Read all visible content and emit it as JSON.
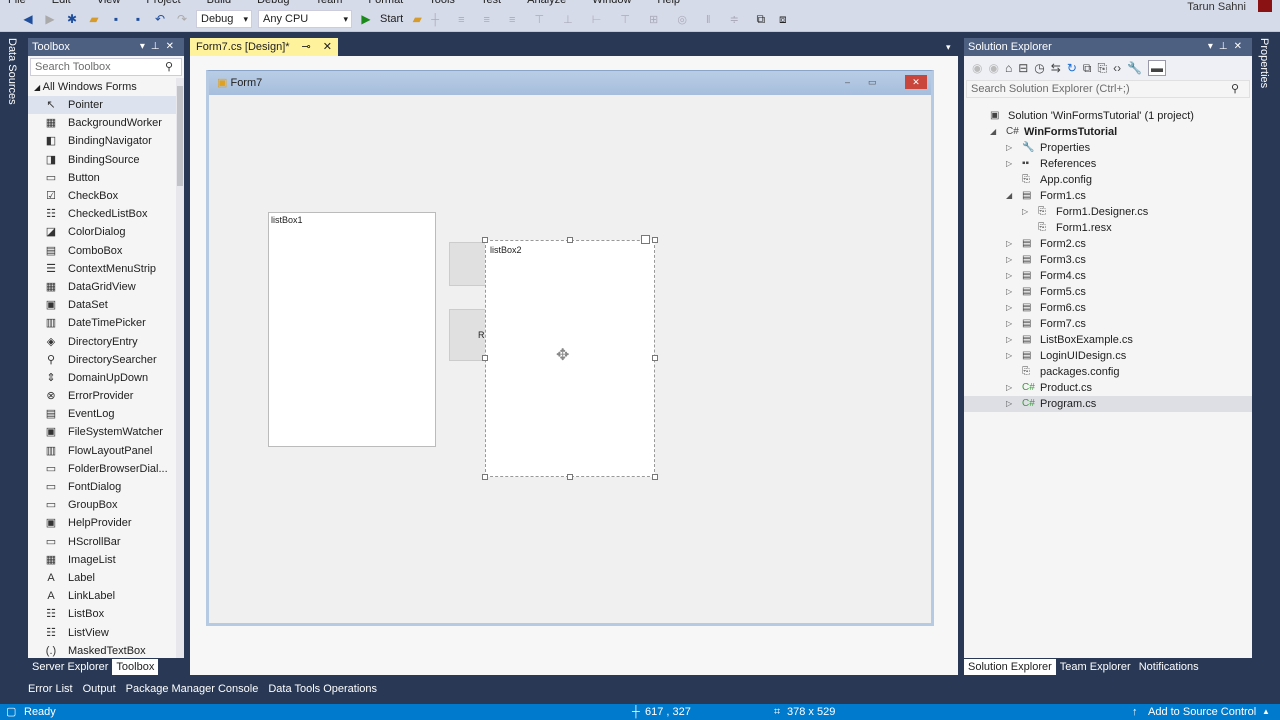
{
  "menu": [
    "File",
    "Edit",
    "View",
    "Project",
    "Build",
    "Debug",
    "Team",
    "Format",
    "Tools",
    "Test",
    "Analyze",
    "Window",
    "Help"
  ],
  "user": "Tarun Sahni",
  "toolbar": {
    "config": "Debug",
    "platform": "Any CPU",
    "start": "Start"
  },
  "left_vtab": "Data Sources",
  "right_vtab": "Properties",
  "toolbox": {
    "title": "Toolbox",
    "search_placeholder": "Search Toolbox",
    "group": "All Windows Forms",
    "items": [
      [
        "Pointer",
        "↖"
      ],
      [
        "BackgroundWorker",
        "▦"
      ],
      [
        "BindingNavigator",
        "◧"
      ],
      [
        "BindingSource",
        "◨"
      ],
      [
        "Button",
        "▭"
      ],
      [
        "CheckBox",
        "☑"
      ],
      [
        "CheckedListBox",
        "☷"
      ],
      [
        "ColorDialog",
        "◪"
      ],
      [
        "ComboBox",
        "▤"
      ],
      [
        "ContextMenuStrip",
        "☰"
      ],
      [
        "DataGridView",
        "▦"
      ],
      [
        "DataSet",
        "▣"
      ],
      [
        "DateTimePicker",
        "▥"
      ],
      [
        "DirectoryEntry",
        "◈"
      ],
      [
        "DirectorySearcher",
        "⚲"
      ],
      [
        "DomainUpDown",
        "⇕"
      ],
      [
        "ErrorProvider",
        "⊗"
      ],
      [
        "EventLog",
        "▤"
      ],
      [
        "FileSystemWatcher",
        "▣"
      ],
      [
        "FlowLayoutPanel",
        "▥"
      ],
      [
        "FolderBrowserDial...",
        "▭"
      ],
      [
        "FontDialog",
        "▭"
      ],
      [
        "GroupBox",
        "▭"
      ],
      [
        "HelpProvider",
        "▣"
      ],
      [
        "HScrollBar",
        "▭"
      ],
      [
        "ImageList",
        "▦"
      ],
      [
        "Label",
        "A"
      ],
      [
        "LinkLabel",
        "A"
      ],
      [
        "ListBox",
        "☷"
      ],
      [
        "ListView",
        "☷"
      ],
      [
        "MaskedTextBox",
        "(.)"
      ]
    ]
  },
  "left_bottom_tabs": [
    "Server Explorer",
    "Toolbox"
  ],
  "doc_tab": "Form7.cs [Design]*",
  "form": {
    "title": "Form7",
    "listbox1": "listBox1",
    "listbox2": "listBox2",
    "button2_partial": "R"
  },
  "solution_explorer": {
    "title": "Solution Explorer",
    "search_placeholder": "Search Solution Explorer (Ctrl+;)",
    "tree": [
      {
        "label": "Solution 'WinFormsTutorial' (1 project)",
        "level": 0,
        "icon": "▣",
        "exp": ""
      },
      {
        "label": "WinFormsTutorial",
        "level": 1,
        "icon": "C#",
        "exp": "◢",
        "bold": true
      },
      {
        "label": "Properties",
        "level": 2,
        "icon": "🔧",
        "exp": "▷"
      },
      {
        "label": "References",
        "level": 2,
        "icon": "▪▪",
        "exp": "▷"
      },
      {
        "label": "App.config",
        "level": 2,
        "icon": "⎘",
        "exp": ""
      },
      {
        "label": "Form1.cs",
        "level": 2,
        "icon": "▤",
        "exp": "◢"
      },
      {
        "label": "Form1.Designer.cs",
        "level": 3,
        "icon": "⎘",
        "exp": "▷"
      },
      {
        "label": "Form1.resx",
        "level": 3,
        "icon": "⎘",
        "exp": ""
      },
      {
        "label": "Form2.cs",
        "level": 2,
        "icon": "▤",
        "exp": "▷"
      },
      {
        "label": "Form3.cs",
        "level": 2,
        "icon": "▤",
        "exp": "▷"
      },
      {
        "label": "Form4.cs",
        "level": 2,
        "icon": "▤",
        "exp": "▷"
      },
      {
        "label": "Form5.cs",
        "level": 2,
        "icon": "▤",
        "exp": "▷"
      },
      {
        "label": "Form6.cs",
        "level": 2,
        "icon": "▤",
        "exp": "▷"
      },
      {
        "label": "Form7.cs",
        "level": 2,
        "icon": "▤",
        "exp": "▷"
      },
      {
        "label": "ListBoxExample.cs",
        "level": 2,
        "icon": "▤",
        "exp": "▷"
      },
      {
        "label": "LoginUIDesign.cs",
        "level": 2,
        "icon": "▤",
        "exp": "▷"
      },
      {
        "label": "packages.config",
        "level": 2,
        "icon": "⎘",
        "exp": ""
      },
      {
        "label": "Product.cs",
        "level": 2,
        "icon": "C#",
        "exp": "▷"
      },
      {
        "label": "Program.cs",
        "level": 2,
        "icon": "C#",
        "exp": "▷",
        "selected": true
      }
    ]
  },
  "right_bottom_tabs": [
    "Solution Explorer",
    "Team Explorer",
    "Notifications"
  ],
  "tool_tabs": [
    "Error List",
    "Output",
    "Package Manager Console",
    "Data Tools Operations"
  ],
  "status": {
    "text": "Ready",
    "position": "617 , 327",
    "size": "378 x 529",
    "source_control": "Add to Source Control"
  }
}
